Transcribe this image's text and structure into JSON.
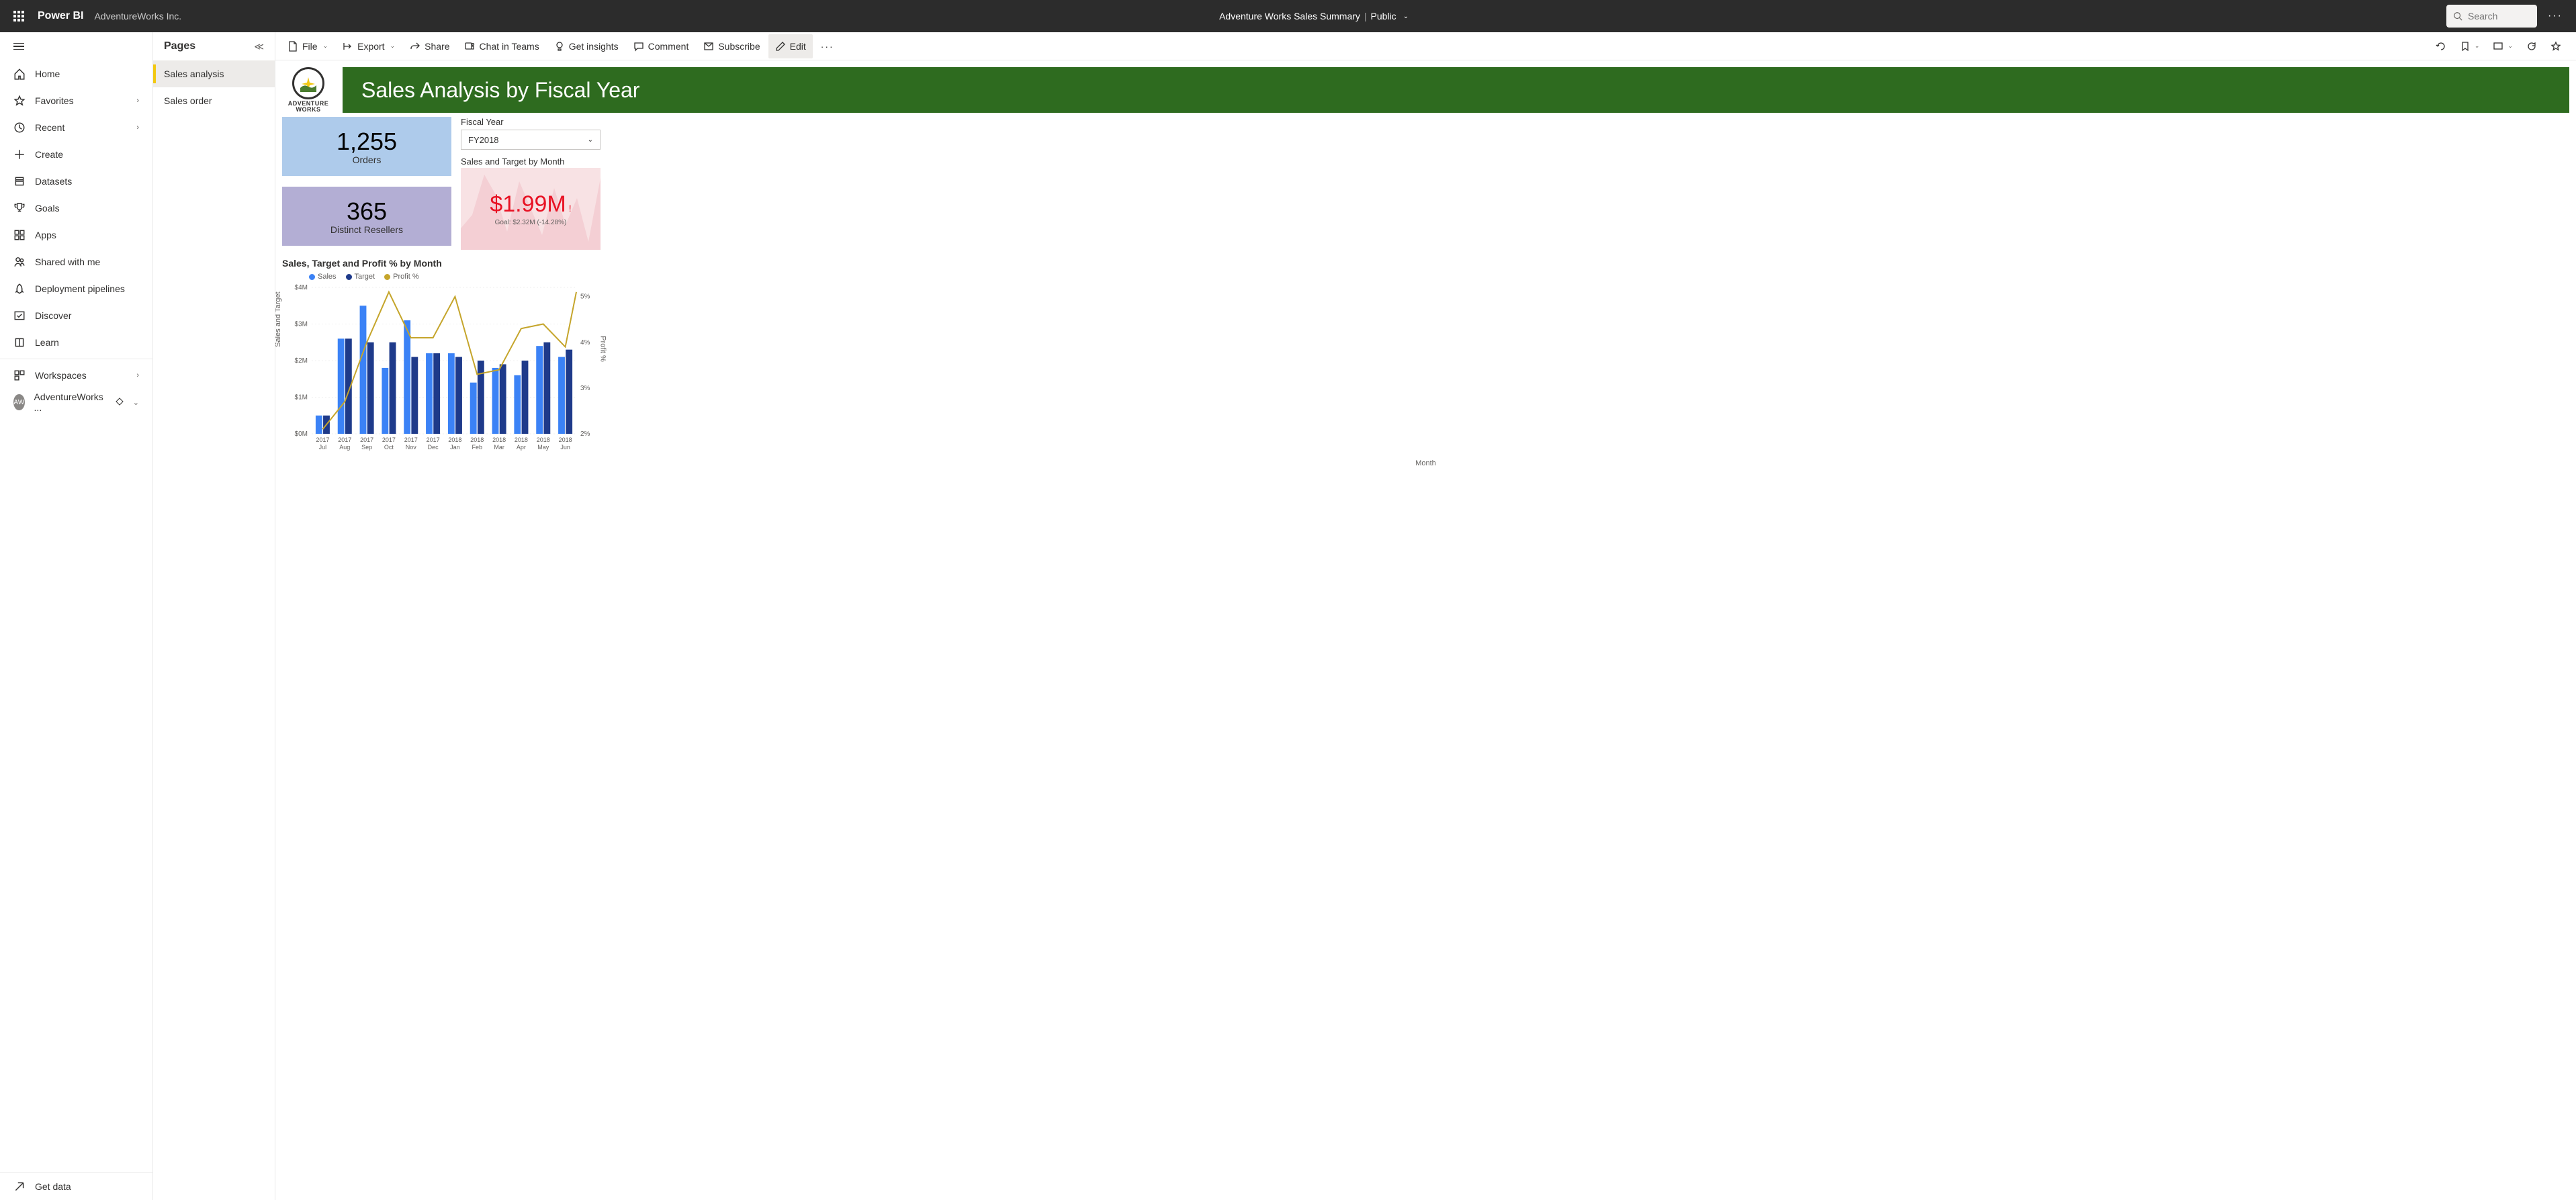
{
  "topbar": {
    "brand": "Power BI",
    "workspace": "AdventureWorks Inc.",
    "report_name": "Adventure Works Sales Summary",
    "visibility": "Public",
    "search_placeholder": "Search"
  },
  "leftnav": {
    "items": [
      {
        "label": "Home",
        "icon": "home"
      },
      {
        "label": "Favorites",
        "icon": "star",
        "chevron": true
      },
      {
        "label": "Recent",
        "icon": "clock",
        "chevron": true
      },
      {
        "label": "Create",
        "icon": "plus"
      },
      {
        "label": "Datasets",
        "icon": "database"
      },
      {
        "label": "Goals",
        "icon": "trophy"
      },
      {
        "label": "Apps",
        "icon": "apps"
      },
      {
        "label": "Shared with me",
        "icon": "people"
      },
      {
        "label": "Deployment pipelines",
        "icon": "rocket"
      },
      {
        "label": "Discover",
        "icon": "discover"
      },
      {
        "label": "Learn",
        "icon": "book"
      }
    ],
    "workspaces_label": "Workspaces",
    "current_workspace": "AdventureWorks ...",
    "get_data": "Get data"
  },
  "pages": {
    "header": "Pages",
    "items": [
      "Sales analysis",
      "Sales order"
    ],
    "active": 0
  },
  "toolbar": {
    "file": "File",
    "export": "Export",
    "share": "Share",
    "chat": "Chat in Teams",
    "insights": "Get insights",
    "comment": "Comment",
    "subscribe": "Subscribe",
    "edit": "Edit"
  },
  "report": {
    "logo_text1": "ADVENTURE",
    "logo_text2": "WORKS",
    "title": "Sales Analysis by Fiscal Year",
    "card1_value": "1,255",
    "card1_label": "Orders",
    "card2_value": "365",
    "card2_label": "Distinct Resellers",
    "slicer_label": "Fiscal Year",
    "slicer_value": "FY2018",
    "kpi_title": "Sales and Target by Month",
    "kpi_value": "$1.99M",
    "kpi_goal": "Goal: $2.32M (-14.28%)",
    "chart_title": "Sales, Target and Profit % by Month",
    "legend": {
      "sales": "Sales",
      "target": "Target",
      "profit": "Profit %"
    },
    "y1_label": "Sales and Target",
    "y2_label": "Profit %",
    "x_label": "Month"
  },
  "chart_data": {
    "type": "bar",
    "categories": [
      "2017 Jul",
      "2017 Aug",
      "2017 Sep",
      "2017 Oct",
      "2017 Nov",
      "2017 Dec",
      "2018 Jan",
      "2018 Feb",
      "2018 Mar",
      "2018 Apr",
      "2018 May",
      "2018 Jun"
    ],
    "series": [
      {
        "name": "Sales",
        "type": "bar",
        "color": "#3b82f6",
        "values": [
          0.5,
          2.6,
          3.5,
          1.8,
          3.1,
          2.2,
          2.2,
          1.4,
          1.8,
          1.6,
          2.4,
          2.1
        ]
      },
      {
        "name": "Target",
        "type": "bar",
        "color": "#1e3a8a",
        "values": [
          0.5,
          2.6,
          2.5,
          2.5,
          2.1,
          2.2,
          2.1,
          2.0,
          1.9,
          2.0,
          2.5,
          2.3
        ]
      },
      {
        "name": "Profit %",
        "type": "line",
        "color": "#c5a52b",
        "axis": "right",
        "values": [
          2.1,
          2.7,
          4.0,
          5.1,
          4.1,
          4.1,
          5.0,
          3.3,
          3.4,
          4.3,
          4.4,
          3.9
        ]
      }
    ],
    "y1_ticks": [
      "$0M",
      "$1M",
      "$2M",
      "$3M",
      "$4M"
    ],
    "y2_ticks": [
      "2%",
      "3%",
      "4%",
      "5%"
    ],
    "y1_range": [
      0,
      4
    ],
    "y2_range": [
      2,
      5.2
    ],
    "last_profit": 5.1
  }
}
